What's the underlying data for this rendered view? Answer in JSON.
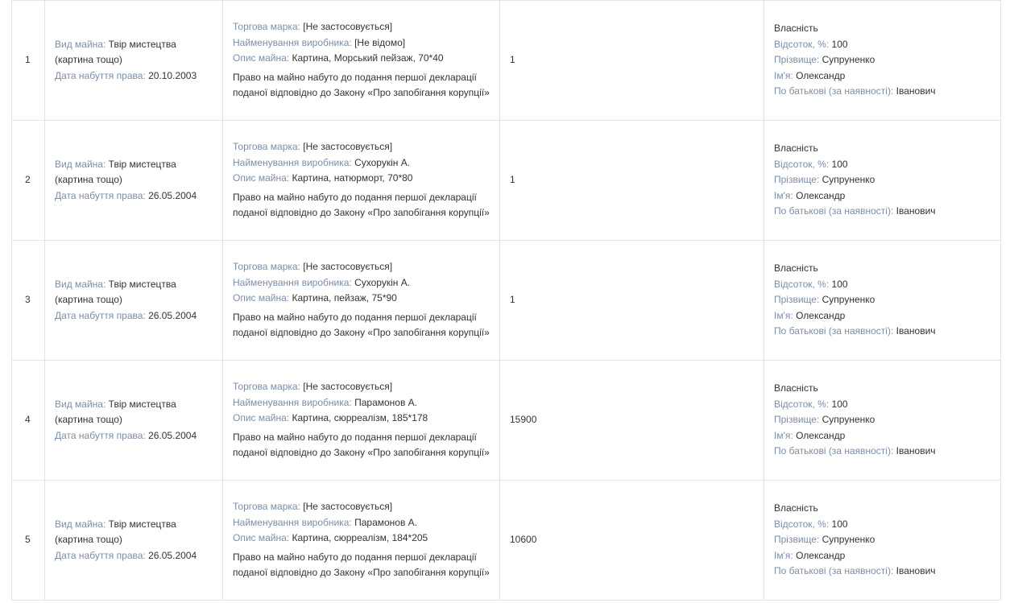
{
  "labels": {
    "type": "Вид майна:",
    "acquired": "Дата набуття права:",
    "brand": "Торгова марка:",
    "maker": "Найменування виробника:",
    "desc": "Опис майна:",
    "ownership": "Власність",
    "percent": "Відсоток, %:",
    "surname": "Прізвище:",
    "name": "Ім'я:",
    "patronymic": "По батькові (за наявності):"
  },
  "rows": [
    {
      "num": "1",
      "type": "Твір мистецтва (картина тощо)",
      "acquired": "20.10.2003",
      "brand": "[Не застосовується]",
      "maker": "[Не відомо]",
      "desc": "Картина, Морський пейзаж, 70*40",
      "note": "Право на майно набуто до подання першої декларації поданої відповідно до Закону «Про запобігання корупції»",
      "cost": "1",
      "percent": "100",
      "surname": "Супруненко",
      "name": "Олександр",
      "patronymic": "Іванович"
    },
    {
      "num": "2",
      "type": "Твір мистецтва (картина тощо)",
      "acquired": "26.05.2004",
      "brand": "[Не застосовується]",
      "maker": "Сухорукін А.",
      "desc": "Картина, натюрморт, 70*80",
      "note": "Право на майно набуто до подання першої декларації поданої відповідно до Закону «Про запобігання корупції»",
      "cost": "1",
      "percent": "100",
      "surname": "Супруненко",
      "name": "Олександр",
      "patronymic": "Іванович"
    },
    {
      "num": "3",
      "type": "Твір мистецтва (картина тощо)",
      "acquired": "26.05.2004",
      "brand": "[Не застосовується]",
      "maker": "Сухорукін А.",
      "desc": "Картина, пейзаж, 75*90",
      "note": "Право на майно набуто до подання першої декларації поданої відповідно до Закону «Про запобігання корупції»",
      "cost": "1",
      "percent": "100",
      "surname": "Супруненко",
      "name": "Олександр",
      "patronymic": "Іванович"
    },
    {
      "num": "4",
      "type": "Твір мистецтва (картина тощо)",
      "acquired": "26.05.2004",
      "brand": "[Не застосовується]",
      "maker": "Парамонов А.",
      "desc": "Картина, сюрреалізм, 185*178",
      "note": "Право на майно набуто до подання першої декларації поданої відповідно до Закону «Про запобігання корупції»",
      "cost": "15900",
      "percent": "100",
      "surname": "Супруненко",
      "name": "Олександр",
      "patronymic": "Іванович"
    },
    {
      "num": "5",
      "type": "Твір мистецтва (картина тощо)",
      "acquired": "26.05.2004",
      "brand": "[Не застосовується]",
      "maker": "Парамонов А.",
      "desc": "Картина, сюрреалізм, 184*205",
      "note": "Право на майно набуто до подання першої декларації поданої відповідно до Закону «Про запобігання корупції»",
      "cost": "10600",
      "percent": "100",
      "surname": "Супруненко",
      "name": "Олександр",
      "patronymic": "Іванович"
    }
  ]
}
